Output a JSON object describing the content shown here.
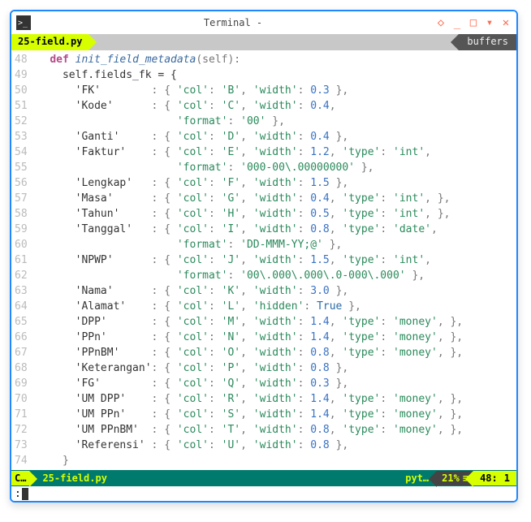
{
  "window": {
    "title": "Terminal -"
  },
  "tab": {
    "active": "25-field.py",
    "right": "buffers"
  },
  "gutter": {
    "start": 48,
    "end": 74
  },
  "code": {
    "fn_def": "def",
    "fn_name": "init_field_metadata",
    "fn_args": "(self):",
    "assign": "self.fields_fk = {",
    "rows": [
      {
        "key": "FK",
        "col": "B",
        "width": "0.3"
      },
      {
        "key": "Kode",
        "col": "C",
        "width": "0.4",
        "format": "00"
      },
      {
        "key": "Ganti",
        "col": "D",
        "width": "0.4"
      },
      {
        "key": "Faktur",
        "col": "E",
        "width": "1.2",
        "type": "int",
        "format": "000-00\\.00000000"
      },
      {
        "key": "Lengkap",
        "col": "F",
        "width": "1.5"
      },
      {
        "key": "Masa",
        "col": "G",
        "width": "0.4",
        "type": "int",
        "trailing_comma": true
      },
      {
        "key": "Tahun",
        "col": "H",
        "width": "0.5",
        "type": "int",
        "trailing_comma": true
      },
      {
        "key": "Tanggal",
        "col": "I",
        "width": "0.8",
        "type": "date",
        "format": "DD-MMM-YY;@"
      },
      {
        "key": "NPWP",
        "col": "J",
        "width": "1.5",
        "type": "int",
        "format": "00\\.000\\.000\\.0-000\\.000"
      },
      {
        "key": "Nama",
        "col": "K",
        "width": "3.0"
      },
      {
        "key": "Alamat",
        "col": "L",
        "hidden": "True"
      },
      {
        "key": "DPP",
        "col": "M",
        "width": "1.4",
        "type": "money"
      },
      {
        "key": "PPn",
        "col": "N",
        "width": "1.4",
        "type": "money"
      },
      {
        "key": "PPnBM",
        "col": "O",
        "width": "0.8",
        "type": "money"
      },
      {
        "key": "Keterangan",
        "col": "P",
        "width": "0.8"
      },
      {
        "key": "FG",
        "col": "Q",
        "width": "0.3"
      },
      {
        "key": "UM DPP",
        "col": "R",
        "width": "1.4",
        "type": "money"
      },
      {
        "key": "UM PPn",
        "col": "S",
        "width": "1.4",
        "type": "money"
      },
      {
        "key": "UM PPnBM",
        "col": "T",
        "width": "0.8",
        "type": "money"
      },
      {
        "key": "Referensi",
        "col": "U",
        "width": "0.8"
      }
    ],
    "close": "}"
  },
  "status": {
    "mode": "C…",
    "file": "25-field.py",
    "filetype": "pyt…",
    "percent": "21%",
    "menu_glyph": "≡",
    "line": "48",
    "col": "1"
  },
  "cmd": {
    "prompt": ":"
  }
}
